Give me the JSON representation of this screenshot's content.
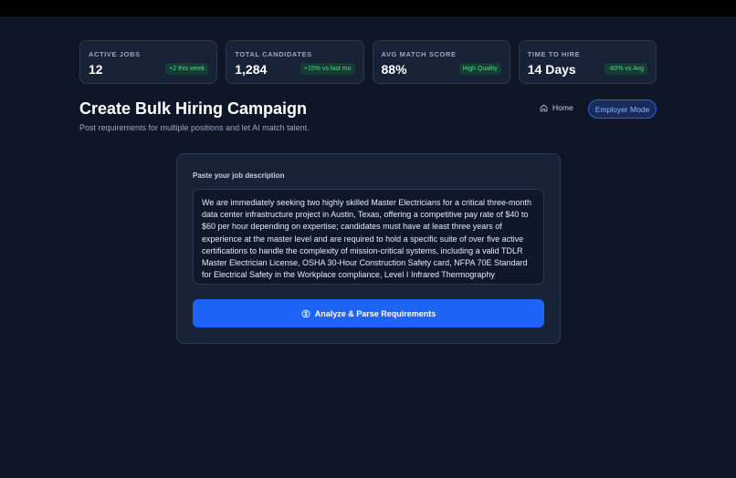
{
  "stats": [
    {
      "label": "ACTIVE JOBS",
      "value": "12",
      "badge": "+2 this week"
    },
    {
      "label": "TOTAL CANDIDATES",
      "value": "1,284",
      "badge": "+15% vs last mo"
    },
    {
      "label": "AVG MATCH SCORE",
      "value": "88%",
      "badge": "High Quality"
    },
    {
      "label": "TIME TO HIRE",
      "value": "14 Days",
      "badge": "-60% vs Avg"
    }
  ],
  "header": {
    "title": "Create Bulk Hiring Campaign",
    "subtitle": "Post requirements for multiple positions and let AI match talent.",
    "home_label": "Home",
    "mode_label": "Employer Mode"
  },
  "form": {
    "label": "Paste your job description",
    "job_description": "We are immediately seeking two highly skilled Master Electricians for a critical three-month data center infrastructure project in Austin, Texas, offering a competitive pay rate of $40 to $60 per hour depending on expertise; candidates must have at least three years of experience at the master level and are required to hold a specific suite of over five active certifications to handle the complexity of mission-critical systems, including a valid TDLR Master Electrician License, OSHA 30-Hour Construction Safety card, NFPA 70E Standard for Electrical Safety in the Workplace compliance, Level I Infrared Thermography",
    "submit_label": "Analyze & Parse Requirements"
  },
  "colors": {
    "background": "#0e1628",
    "card": "#172236",
    "accent": "#1d63f5",
    "badge_text": "#4ade80"
  },
  "icons": {
    "home": "home-icon",
    "analyze": "brain-icon"
  }
}
